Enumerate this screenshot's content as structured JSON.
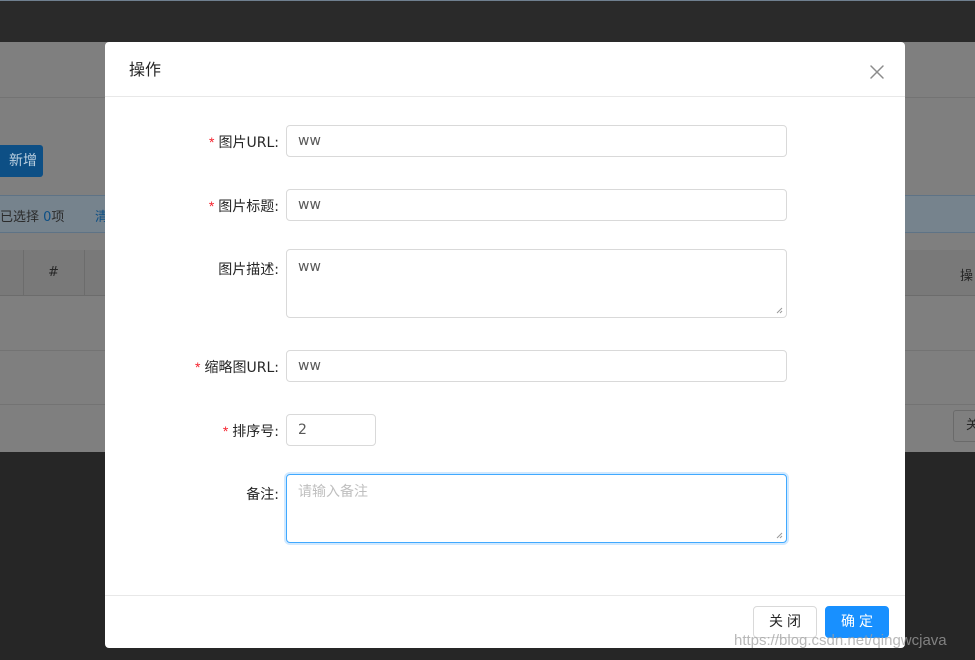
{
  "background": {
    "add_button_label": "新增",
    "alert_prefix": "已选择 ",
    "alert_count": "0",
    "alert_suffix": "项",
    "clear_link": "清",
    "table_header_index": "#",
    "table_header_actions": "操",
    "pagination_button": "关"
  },
  "modal": {
    "title": "操作",
    "fields": [
      {
        "label": "图片URL:",
        "required": true,
        "value": "ww"
      },
      {
        "label": "图片标题:",
        "required": true,
        "value": "ww"
      },
      {
        "label": "图片描述:",
        "required": false,
        "value": "ww"
      },
      {
        "label": "缩略图URL:",
        "required": true,
        "value": "ww"
      },
      {
        "label": "排序号:",
        "required": true,
        "value": "2"
      },
      {
        "label": "备注:",
        "required": false,
        "value": "",
        "placeholder": "请输入备注"
      }
    ],
    "required_mark": "*",
    "cancel_label": "关闭",
    "ok_label": "确定"
  },
  "watermark": "https://blog.csdn.net/qingwcjava",
  "colors": {
    "primary": "#1890ff",
    "required": "#f5222d",
    "focus_border": "#40a9ff"
  },
  "icons": {
    "close": "close-icon",
    "resize": "resize-handle-icon"
  }
}
